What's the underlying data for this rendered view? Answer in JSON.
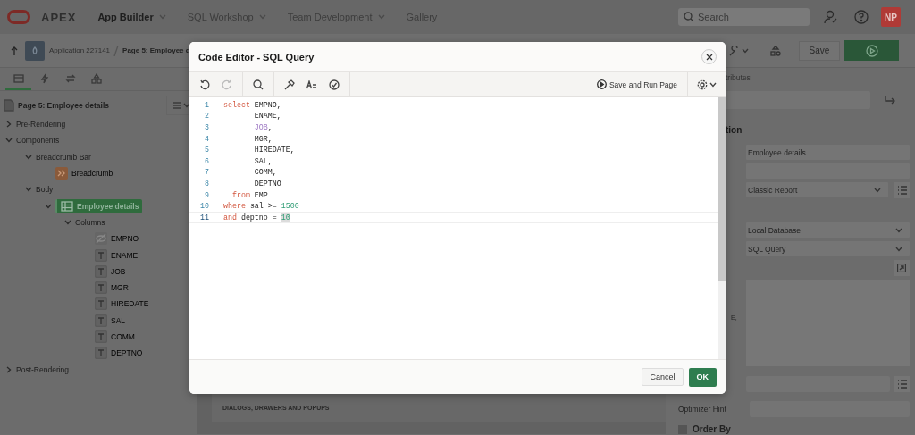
{
  "top_nav": {
    "logo_text": "APEX",
    "menus": [
      {
        "label": "App Builder",
        "selected": true,
        "has_menu": true
      },
      {
        "label": "SQL Workshop",
        "selected": false,
        "has_menu": true
      },
      {
        "label": "Team Development",
        "selected": false,
        "has_menu": true
      },
      {
        "label": "Gallery",
        "selected": false,
        "has_menu": false
      }
    ],
    "search": {
      "placeholder": "Search"
    },
    "avatar": "NP"
  },
  "toolbar": {
    "breadcrumb": [
      "Application 227141",
      "Page 5: Employee d"
    ],
    "save_button": "Save"
  },
  "left_panel": {
    "tabs": [
      {
        "kind": "rendering",
        "selected": true
      },
      {
        "kind": "dynamic-actions",
        "selected": false
      },
      {
        "kind": "processing",
        "selected": false
      },
      {
        "kind": "shared",
        "selected": false
      }
    ],
    "tree": {
      "label": "Page 5: Employee details",
      "kind": "page",
      "children": [
        {
          "label": "Pre-Rendering",
          "kind": "folder",
          "expanded": false,
          "selected": false
        },
        {
          "label": "Components",
          "kind": "folder",
          "expanded": true,
          "selected": false,
          "children": [
            {
              "label": "Breadcrumb Bar",
              "kind": "folder",
              "expanded": true,
              "selected": false,
              "children": [
                {
                  "label": "Breadcrumb",
                  "kind": "breadcrumb",
                  "selected": false
                }
              ]
            },
            {
              "label": "Body",
              "kind": "folder",
              "expanded": true,
              "selected": false,
              "children": [
                {
                  "label": "Employee details",
                  "kind": "report",
                  "expanded": true,
                  "selected": true,
                  "children": [
                    {
                      "label": "Columns",
                      "kind": "folder",
                      "expanded": true,
                      "selected": false,
                      "children": [
                        {
                          "label": "EMPNO",
                          "kind": "hidden-column",
                          "selected": false
                        },
                        {
                          "label": "ENAME",
                          "kind": "text-column",
                          "selected": false
                        },
                        {
                          "label": "JOB",
                          "kind": "text-column",
                          "selected": false
                        },
                        {
                          "label": "MGR",
                          "kind": "text-column",
                          "selected": false
                        },
                        {
                          "label": "HIREDATE",
                          "kind": "text-column",
                          "selected": false
                        },
                        {
                          "label": "SAL",
                          "kind": "text-column",
                          "selected": false
                        },
                        {
                          "label": "COMM",
                          "kind": "text-column",
                          "selected": false
                        },
                        {
                          "label": "DEPTNO",
                          "kind": "text-column",
                          "selected": false
                        }
                      ]
                    }
                  ]
                }
              ]
            }
          ]
        },
        {
          "label": "Post-Rendering",
          "kind": "folder",
          "expanded": false,
          "selected": false
        }
      ]
    }
  },
  "canvas": {
    "region_label": "DIALOGS, DRAWERS AND POPUPS"
  },
  "right_panel": {
    "tab_label": "tributes",
    "section_title": "tion",
    "fields": [
      {
        "kind": "text",
        "value": "Employee details"
      },
      {
        "kind": "text"
      },
      {
        "kind": "select",
        "value": "Classic Report",
        "has_list_button": true
      },
      {
        "kind": "select",
        "value": "Local Database",
        "has_list_button": false
      },
      {
        "kind": "select",
        "value": "SQL Query",
        "has_list_button": false
      }
    ],
    "code_preview": "E,",
    "optimizer_hint_label": "Optimizer Hint",
    "order_by_title": "Order By"
  },
  "dialog": {
    "title": "Code Editor - SQL Query",
    "save_and_run": "Save and Run Page",
    "lines": [
      {
        "number": "1",
        "kind": "statement",
        "current": false,
        "tokens": [
          {
            "kind": "keyword",
            "text": "select"
          },
          {
            "kind": "plain",
            "text": " EMPNO,"
          }
        ]
      },
      {
        "number": "2",
        "kind": "select-list",
        "current": false,
        "tokens": [
          {
            "kind": "plain",
            "text": "ENAME,"
          }
        ]
      },
      {
        "number": "3",
        "kind": "select-list",
        "current": false,
        "tokens": [
          {
            "kind": "column",
            "text": "JOB"
          },
          {
            "kind": "plain",
            "text": ","
          }
        ]
      },
      {
        "number": "4",
        "kind": "select-list",
        "current": false,
        "tokens": [
          {
            "kind": "plain",
            "text": "MGR,"
          }
        ]
      },
      {
        "number": "5",
        "kind": "select-list",
        "current": false,
        "tokens": [
          {
            "kind": "plain",
            "text": "HIREDATE,"
          }
        ]
      },
      {
        "number": "6",
        "kind": "select-list",
        "current": false,
        "tokens": [
          {
            "kind": "plain",
            "text": "SAL,"
          }
        ]
      },
      {
        "number": "7",
        "kind": "select-list",
        "current": false,
        "tokens": [
          {
            "kind": "plain",
            "text": "COMM,"
          }
        ]
      },
      {
        "number": "8",
        "kind": "select-list",
        "current": false,
        "tokens": [
          {
            "kind": "plain",
            "text": "DEPTNO"
          }
        ]
      },
      {
        "number": "9",
        "kind": "clause",
        "current": false,
        "tokens": [
          {
            "kind": "keyword",
            "text": "from"
          },
          {
            "kind": "plain",
            "text": " EMP"
          }
        ]
      },
      {
        "number": "10",
        "kind": "statement",
        "current": false,
        "tokens": [
          {
            "kind": "keyword",
            "text": "where"
          },
          {
            "kind": "plain",
            "text": " sal >= "
          },
          {
            "kind": "number",
            "text": "1500"
          }
        ]
      },
      {
        "number": "11",
        "kind": "statement",
        "current": true,
        "tokens": [
          {
            "kind": "keyword",
            "text": "and"
          },
          {
            "kind": "plain",
            "text": " deptno = "
          },
          {
            "kind": "number-match",
            "text": "10"
          }
        ]
      }
    ],
    "buttons": [
      {
        "kind": "secondary",
        "label": "Cancel"
      },
      {
        "kind": "primary",
        "label": "OK"
      }
    ]
  }
}
